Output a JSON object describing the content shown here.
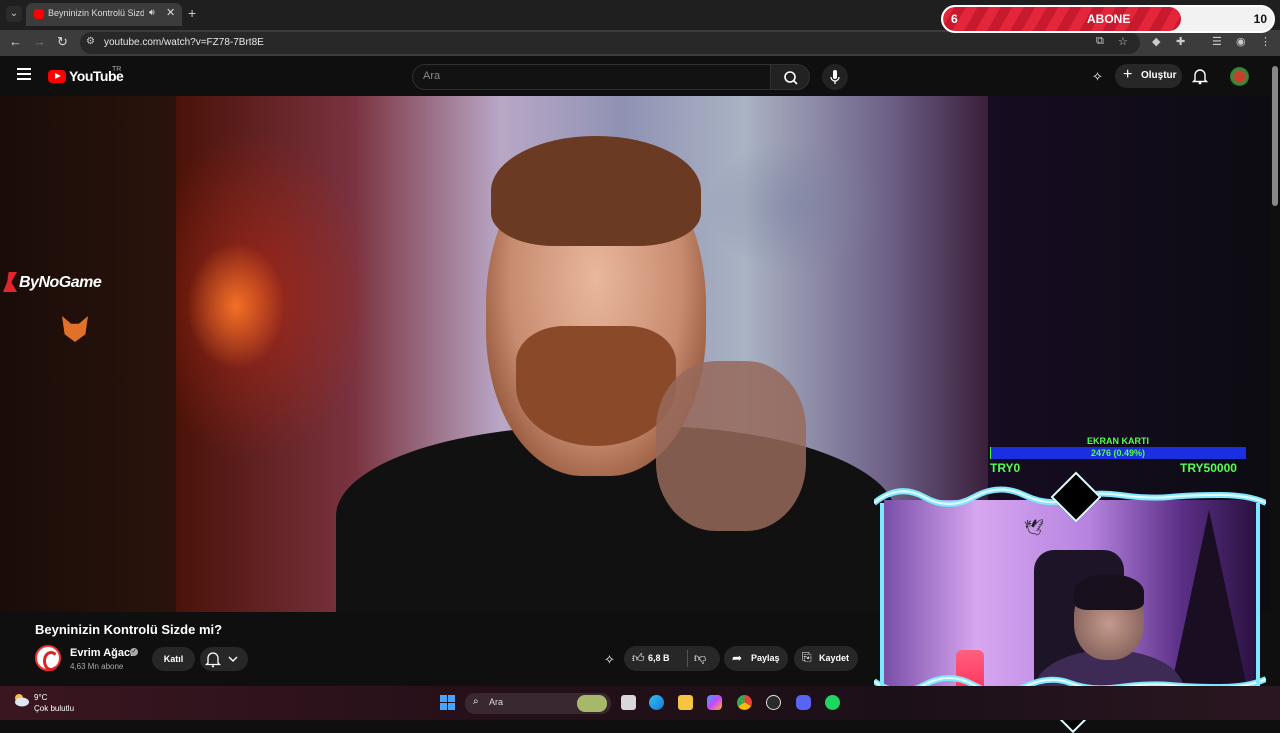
{
  "browser": {
    "tab_title": "Beyninizin Kontrolü Sizde mi?",
    "url": "youtube.com/watch?v=FZ78-7Brt8E"
  },
  "stream_overlays": {
    "abone_goal": {
      "label": "ABONE",
      "start": "6",
      "end": "10",
      "progress": 0.72,
      "color": "#e3263a"
    },
    "donation_goal": {
      "title": "EKRAN KARTI",
      "value_text": "2476 (0.49%)",
      "min_label": "TRY0",
      "max_label": "TRY50000",
      "progress": 0.0049,
      "text_color": "#52ff52",
      "bar_color": "#1a2fe0"
    },
    "brand_name": "ByNoGame"
  },
  "youtube": {
    "logo_text": "YouTube",
    "country_code": "TR",
    "search": {
      "placeholder": "Ara"
    },
    "create_label": "Oluştur",
    "video": {
      "title": "Beyninizin Kontrolü Sizde mi?",
      "channel_name": "Evrim Ağacı",
      "subscribers": "4,63 Mn abone",
      "join_label": "Katıl",
      "likes": "6,8 B",
      "share_label": "Paylaş",
      "save_label": "Kaydet"
    },
    "accent": "#ff0000"
  },
  "taskbar": {
    "weather_temp": "9°C",
    "weather_desc": "Çok bulutlu",
    "search_label": "Ara",
    "apps": [
      "start-icon",
      "search-icon",
      "bing-icon",
      "file-explorer-icon",
      "edge-icon",
      "folder-icon",
      "copilot-icon",
      "chrome-icon",
      "obs-icon",
      "discord-icon",
      "spotify-icon"
    ]
  }
}
